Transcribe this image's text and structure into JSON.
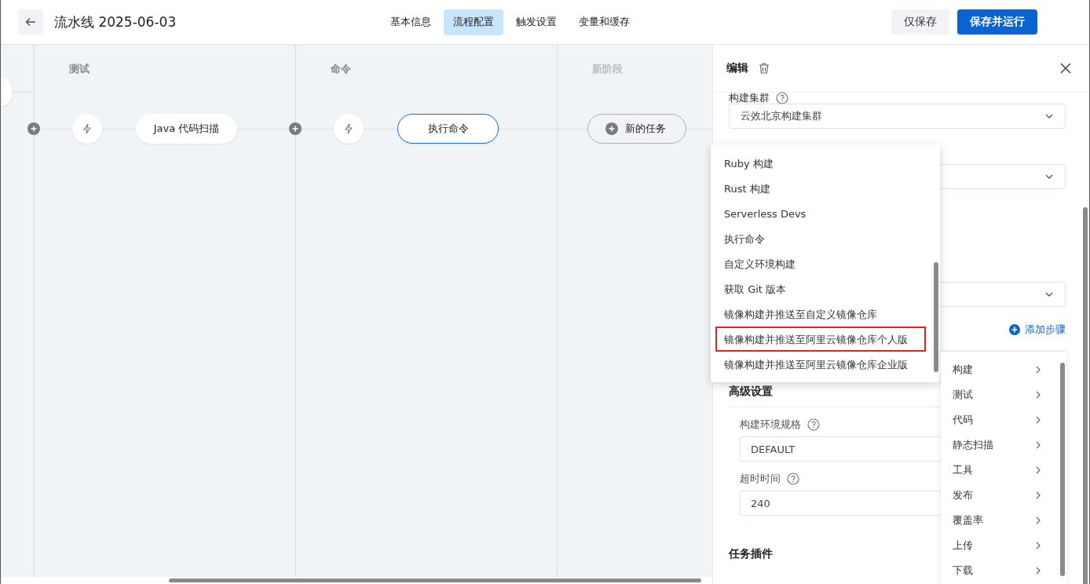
{
  "header": {
    "title": "流水线 2025-06-03",
    "tabs": [
      {
        "label": "基本信息",
        "selected": false
      },
      {
        "label": "流程配置",
        "selected": true
      },
      {
        "label": "触发设置",
        "selected": false
      },
      {
        "label": "变量和缓存",
        "selected": false
      }
    ],
    "buttons": [
      {
        "label": "仅保存",
        "kind": "secondary"
      },
      {
        "label": "保存并运行",
        "kind": "primary"
      }
    ]
  },
  "stages": [
    {
      "title": "测试",
      "kind": "stage",
      "tasks": [
        {
          "label": "Java 代码扫描",
          "selected": false
        }
      ]
    },
    {
      "title": "命令",
      "kind": "stage",
      "tasks": [
        {
          "label": "执行命令",
          "selected": true
        }
      ]
    },
    {
      "title": "新阶段",
      "kind": "new",
      "tasks": [
        {
          "label": "新的任务",
          "selected": false
        }
      ]
    }
  ],
  "panel": {
    "title": "编辑",
    "fields": [
      {
        "label": "构建集群",
        "value": "云效北京构建集群"
      },
      {
        "kind": "select"
      },
      {
        "kind": "select"
      }
    ],
    "add_step": "添加步骤",
    "advanced": {
      "title": "高级设置",
      "fields": [
        {
          "label": "构建环境规格",
          "value": "DEFAULT"
        },
        {
          "label": "超时时间",
          "value": "240"
        }
      ]
    },
    "plugins_title": "任务插件"
  },
  "dropdown": {
    "items": [
      {
        "label": "Ruby 构建",
        "highlighted": false
      },
      {
        "label": "Rust 构建",
        "highlighted": false
      },
      {
        "label": "Serverless Devs",
        "highlighted": false
      },
      {
        "label": "执行命令",
        "highlighted": false
      },
      {
        "label": "自定义环境构建",
        "highlighted": false
      },
      {
        "label": "获取 Git 版本",
        "highlighted": false
      },
      {
        "label": "镜像构建并推送至自定义镜像仓库",
        "highlighted": false
      },
      {
        "label": "镜像构建并推送至阿里云镜像仓库个人版",
        "highlighted": true
      },
      {
        "label": "镜像构建并推送至阿里云镜像仓库企业版",
        "highlighted": false
      }
    ]
  },
  "category_menu": {
    "items": [
      {
        "label": "构建"
      },
      {
        "label": "测试"
      },
      {
        "label": "代码"
      },
      {
        "label": "静态扫描"
      },
      {
        "label": "工具"
      },
      {
        "label": "发布"
      },
      {
        "label": "覆盖率"
      },
      {
        "label": "上传"
      },
      {
        "label": "下载"
      }
    ]
  }
}
